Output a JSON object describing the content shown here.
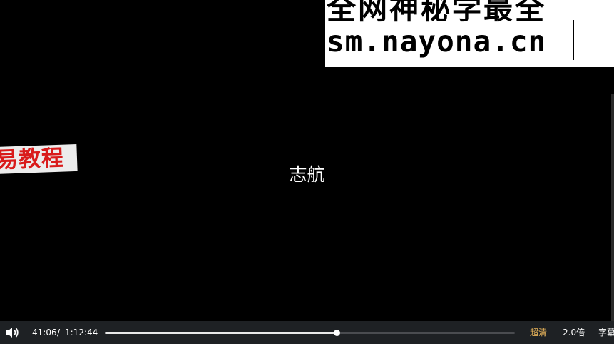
{
  "watermark": {
    "line1": "全网神秘学最全",
    "line2": "sm.nayona.cn"
  },
  "stamp_text": "易教程",
  "center_text": "志航",
  "player": {
    "current_time": "41:06",
    "separator": "/",
    "duration": "1:12:44",
    "progress_fraction": 0.565,
    "quality_label": "超清",
    "speed_label": "2.0倍",
    "subtitle_label": "字幕",
    "volume_icon": "speaker-icon"
  },
  "colors": {
    "control_bar": "#1e2124",
    "quality_accent": "#e6b35a",
    "stamp_red": "#d91b1b"
  }
}
